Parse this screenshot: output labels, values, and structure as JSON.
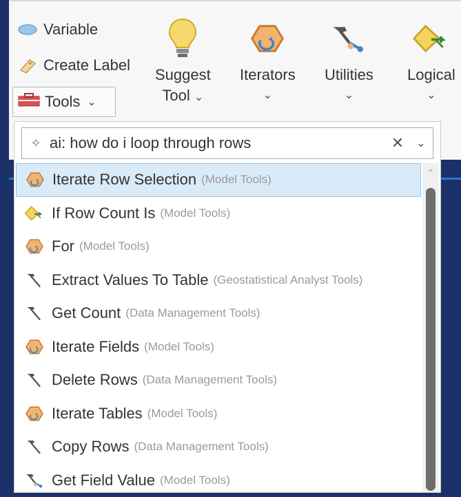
{
  "ribbon": {
    "variable_label": "Variable",
    "create_label_label": "Create Label",
    "tools_label": "Tools",
    "buttons": [
      {
        "line1": "Suggest",
        "line2": "Tool",
        "icon": "lightbulb-icon"
      },
      {
        "line1": "Iterators",
        "line2": "",
        "icon": "iterator-icon"
      },
      {
        "line1": "Utilities",
        "line2": "",
        "icon": "utilities-icon"
      },
      {
        "line1": "Logical",
        "line2": "",
        "icon": "logical-icon"
      }
    ]
  },
  "search": {
    "value": "ai: how do i loop through rows"
  },
  "results": [
    {
      "name": "Iterate Row Selection",
      "category": "(Model Tools)",
      "icon": "iterator-icon",
      "selected": true
    },
    {
      "name": "If Row Count Is",
      "category": "(Model Tools)",
      "icon": "logical-icon",
      "selected": false
    },
    {
      "name": "For",
      "category": "(Model Tools)",
      "icon": "iterator-icon",
      "selected": false
    },
    {
      "name": "Extract Values To Table",
      "category": "(Geostatistical Analyst Tools)",
      "icon": "hammer-icon",
      "selected": false
    },
    {
      "name": "Get Count",
      "category": "(Data Management Tools)",
      "icon": "hammer-icon",
      "selected": false
    },
    {
      "name": "Iterate Fields",
      "category": "(Model Tools)",
      "icon": "iterator-icon",
      "selected": false
    },
    {
      "name": "Delete Rows",
      "category": "(Data Management Tools)",
      "icon": "hammer-icon",
      "selected": false
    },
    {
      "name": "Iterate Tables",
      "category": "(Model Tools)",
      "icon": "iterator-icon",
      "selected": false
    },
    {
      "name": "Copy Rows",
      "category": "(Data Management Tools)",
      "icon": "hammer-icon",
      "selected": false
    },
    {
      "name": "Get Field Value",
      "category": "(Model Tools)",
      "icon": "utilities-icon",
      "selected": false
    }
  ],
  "colors": {
    "background": "#1b3268",
    "selection": "#d9ebf9",
    "accent": "#2b79d3"
  }
}
